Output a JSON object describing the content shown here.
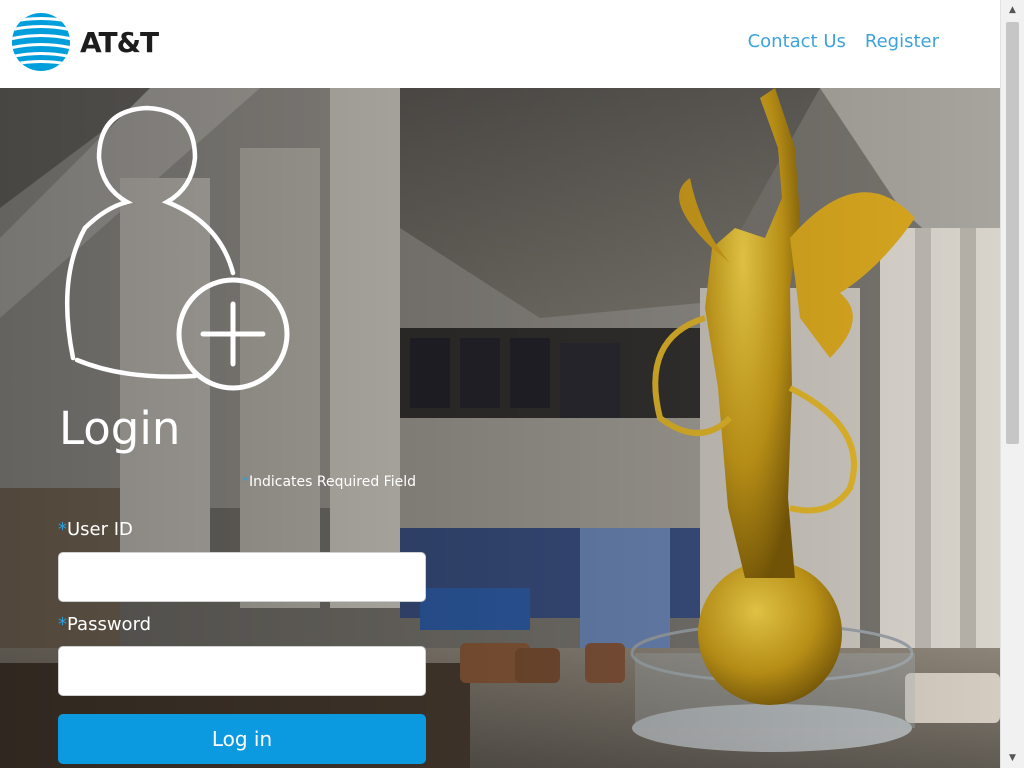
{
  "brand": {
    "name": "AT&T",
    "logo_icon": "att-globe-icon",
    "color": "#009fdb"
  },
  "nav": {
    "contact_us": "Contact Us",
    "register": "Register",
    "link_color": "#3ea3d9"
  },
  "login": {
    "icon": "add-user-icon",
    "title": "Login",
    "required_note": "Indicates Required Field",
    "required_marker": "*",
    "user_id_label": "User ID",
    "user_id_value": "",
    "password_label": "Password",
    "password_value": "",
    "submit_label": "Log in",
    "button_color": "#0b9ae0"
  },
  "scrollbar": {
    "up_icon": "scroll-up-arrow-icon",
    "down_icon": "scroll-down-arrow-icon"
  }
}
